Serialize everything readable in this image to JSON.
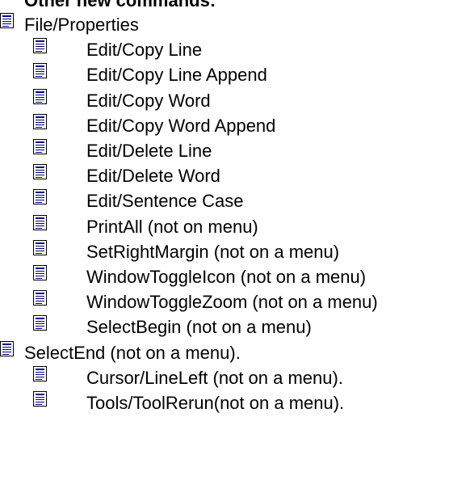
{
  "doc": {
    "heading": "Other new commands:",
    "items": [
      {
        "label": "File/Properties",
        "level": 0
      },
      {
        "label": "Edit/Copy Line",
        "level": 1
      },
      {
        "label": "Edit/Copy Line Append",
        "level": 1
      },
      {
        "label": "Edit/Copy Word",
        "level": 1
      },
      {
        "label": "Edit/Copy Word Append",
        "level": 1
      },
      {
        "label": "Edit/Delete Line",
        "level": 1
      },
      {
        "label": "Edit/Delete Word",
        "level": 1
      },
      {
        "label": "Edit/Sentence Case",
        "level": 1
      },
      {
        "label": "PrintAll (not on menu)",
        "level": 1
      },
      {
        "label": "SetRightMargin (not on a menu)",
        "level": 1
      },
      {
        "label": "WindowToggleIcon (not on a menu)",
        "level": 1
      },
      {
        "label": "WindowToggleZoom (not on a menu)",
        "level": 1
      },
      {
        "label": "SelectBegin (not on a menu)",
        "level": 1
      },
      {
        "label": "SelectEnd (not on a menu).",
        "level": 0
      },
      {
        "label": "Cursor/LineLeft (not on a menu).",
        "level": 1
      },
      {
        "label": "Tools/ToolRerun(not on a menu).",
        "level": 1
      }
    ]
  }
}
